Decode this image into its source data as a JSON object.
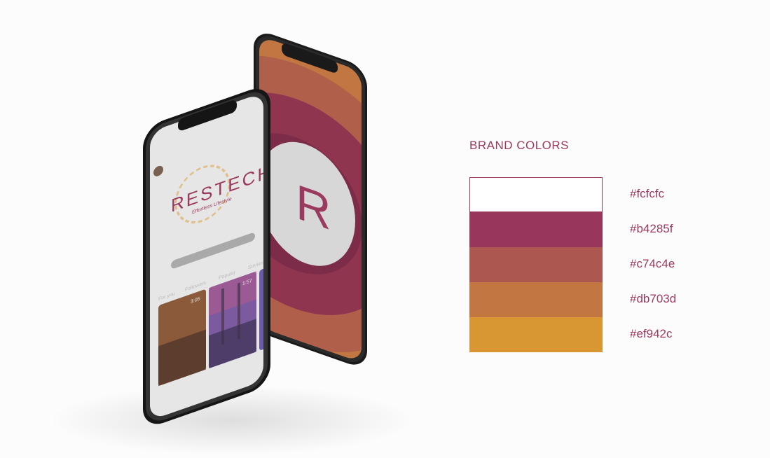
{
  "heading": "BRAND COLORS",
  "colors": [
    {
      "label": "#fcfcfc",
      "swatch": "#ffffff"
    },
    {
      "label": "#b4285f",
      "swatch": "#98365c"
    },
    {
      "label": "#c74c4e",
      "swatch": "#ac5750"
    },
    {
      "label": "#db703d",
      "swatch": "#c27641"
    },
    {
      "label": "#ef942c",
      "swatch": "#d99734"
    }
  ],
  "app": {
    "logo_text": "RESTECH",
    "tagline": "Effortless Lifestyle",
    "tabs": [
      "For you",
      "Followers",
      "Popular",
      "Stories"
    ],
    "cards": [
      {
        "duration": "3:05"
      },
      {
        "duration": "1:57"
      }
    ],
    "splash_letter": "R"
  }
}
